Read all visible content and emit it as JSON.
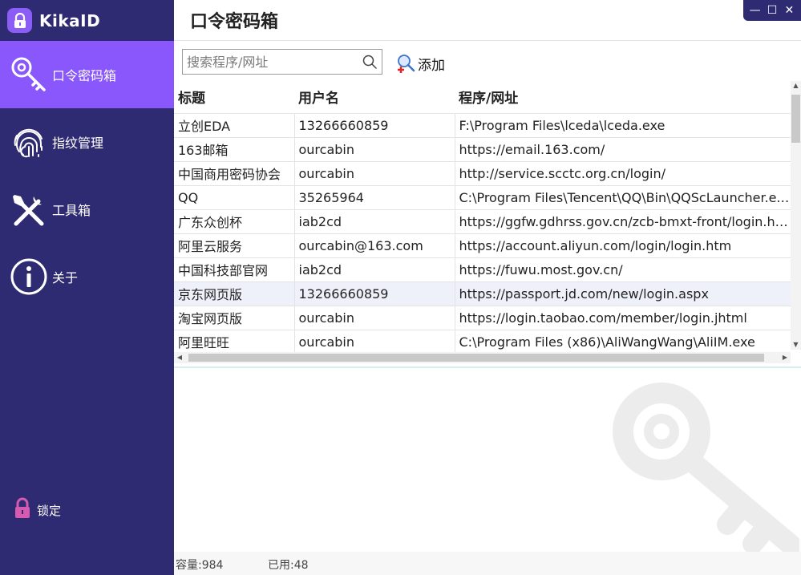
{
  "app": {
    "name": "KikaID"
  },
  "sidebar": {
    "items": [
      {
        "label": "口令密码箱",
        "icon": "key-icon",
        "active": true
      },
      {
        "label": "指纹管理",
        "icon": "fingerprint-icon",
        "active": false
      },
      {
        "label": "工具箱",
        "icon": "tools-icon",
        "active": false
      },
      {
        "label": "关于",
        "icon": "info-icon",
        "active": false
      }
    ],
    "lock_label": "锁定"
  },
  "header": {
    "title": "口令密码箱"
  },
  "search": {
    "placeholder": "搜索程序/网址",
    "value": ""
  },
  "toolbar": {
    "add_label": "添加"
  },
  "table": {
    "columns": [
      "标题",
      "用户名",
      "程序/网址"
    ],
    "rows": [
      [
        "立创EDA",
        "13266660859",
        "F:\\Program Files\\lceda\\lceda.exe"
      ],
      [
        "163邮箱",
        "ourcabin",
        "https://email.163.com/"
      ],
      [
        "中国商用密码协会",
        "ourcabin",
        "http://service.scctc.org.cn/login/"
      ],
      [
        "QQ",
        "35265964",
        "C:\\Program Files\\Tencent\\QQ\\Bin\\QQScLauncher.exe"
      ],
      [
        "广东众创杯",
        "iab2cd",
        "https://ggfw.gdhrss.gov.cn/zcb-bmxt-front/login.html"
      ],
      [
        "阿里云服务",
        "ourcabin@163.com",
        "https://account.aliyun.com/login/login.htm"
      ],
      [
        "中国科技部官网",
        "iab2cd",
        "https://fuwu.most.gov.cn/"
      ],
      [
        "京东网页版",
        "13266660859",
        "https://passport.jd.com/new/login.aspx"
      ],
      [
        "淘宝网页版",
        "ourcabin",
        "https://login.taobao.com/member/login.jhtml"
      ],
      [
        "阿里旺旺",
        "ourcabin",
        "C:\\Program Files (x86)\\AliWangWang\\AliIM.exe"
      ]
    ],
    "selected_row": 7
  },
  "footer": {
    "capacity": "容量:984",
    "used": "已用:48"
  },
  "colors": {
    "sidebar": "#2f2b72",
    "active": "#8957fb",
    "accent": "#8b5cf6",
    "lock": "#d65ab0"
  }
}
